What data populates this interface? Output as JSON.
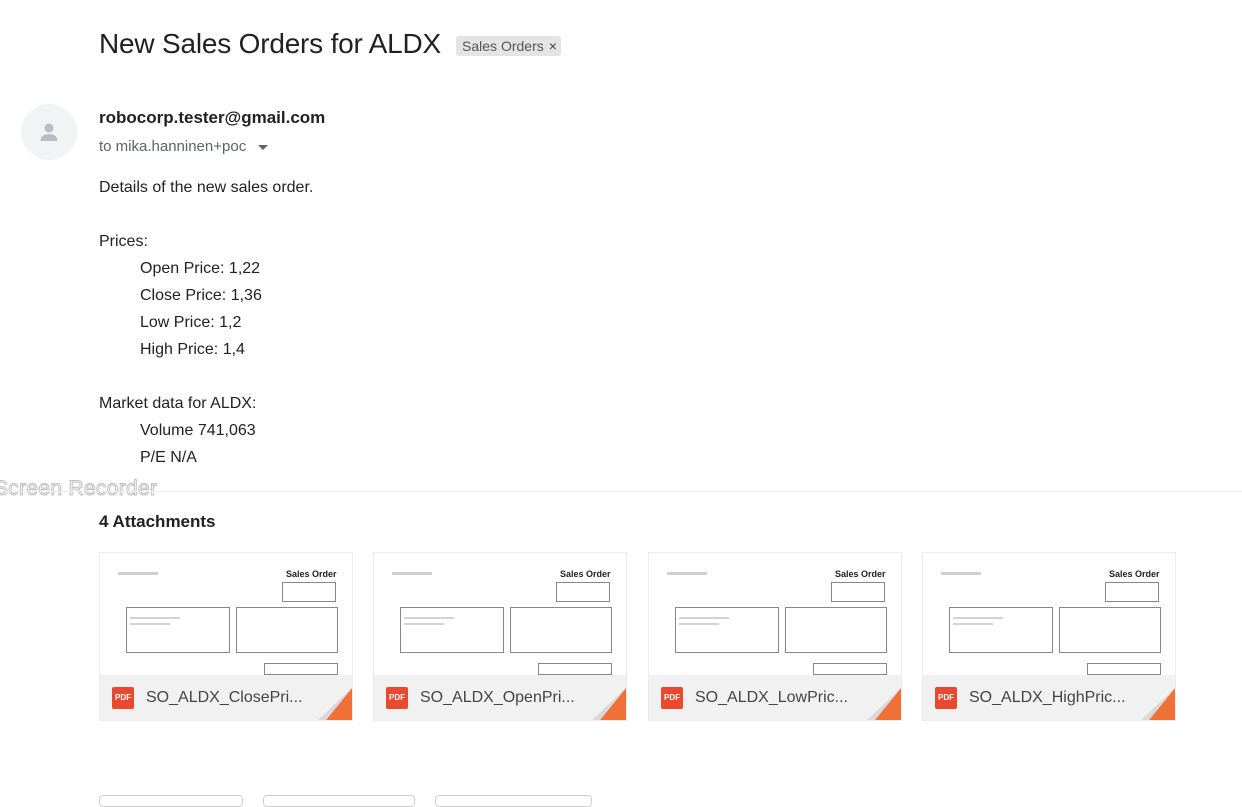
{
  "email": {
    "subject": "New Sales Orders for ALDX",
    "label": "Sales Orders",
    "label_remove": "×",
    "sender": "robocorp.tester@gmail.com",
    "recipient": "to mika.hanninen+poc",
    "body": {
      "intro": "Details of the new sales order.",
      "prices_heading": "Prices:",
      "prices": [
        "Open Price: 1,22",
        "Close Price: 1,36",
        "Low Price: 1,2",
        "High Price: 1,4"
      ],
      "market_heading": "Market data for ALDX:",
      "market": [
        "Volume 741,063",
        "P/E N/A"
      ]
    }
  },
  "watermark": "Screen Recorder",
  "attachments": {
    "title": "4 Attachments",
    "items": [
      {
        "name": "SO_ALDX_ClosePri...",
        "type_badge": "PDF",
        "preview_title": "Sales Order"
      },
      {
        "name": "SO_ALDX_OpenPri...",
        "type_badge": "PDF",
        "preview_title": "Sales Order"
      },
      {
        "name": "SO_ALDX_LowPric...",
        "type_badge": "PDF",
        "preview_title": "Sales Order"
      },
      {
        "name": "SO_ALDX_HighPric...",
        "type_badge": "PDF",
        "preview_title": "Sales Order"
      }
    ]
  },
  "colors": {
    "pdf_red": "#e8492f",
    "fold_orange": "#f07138",
    "chip_bg": "#e4e4e4"
  },
  "icons": [
    "default-avatar-icon",
    "chevron-down-icon",
    "pdf-icon",
    "close-icon"
  ]
}
